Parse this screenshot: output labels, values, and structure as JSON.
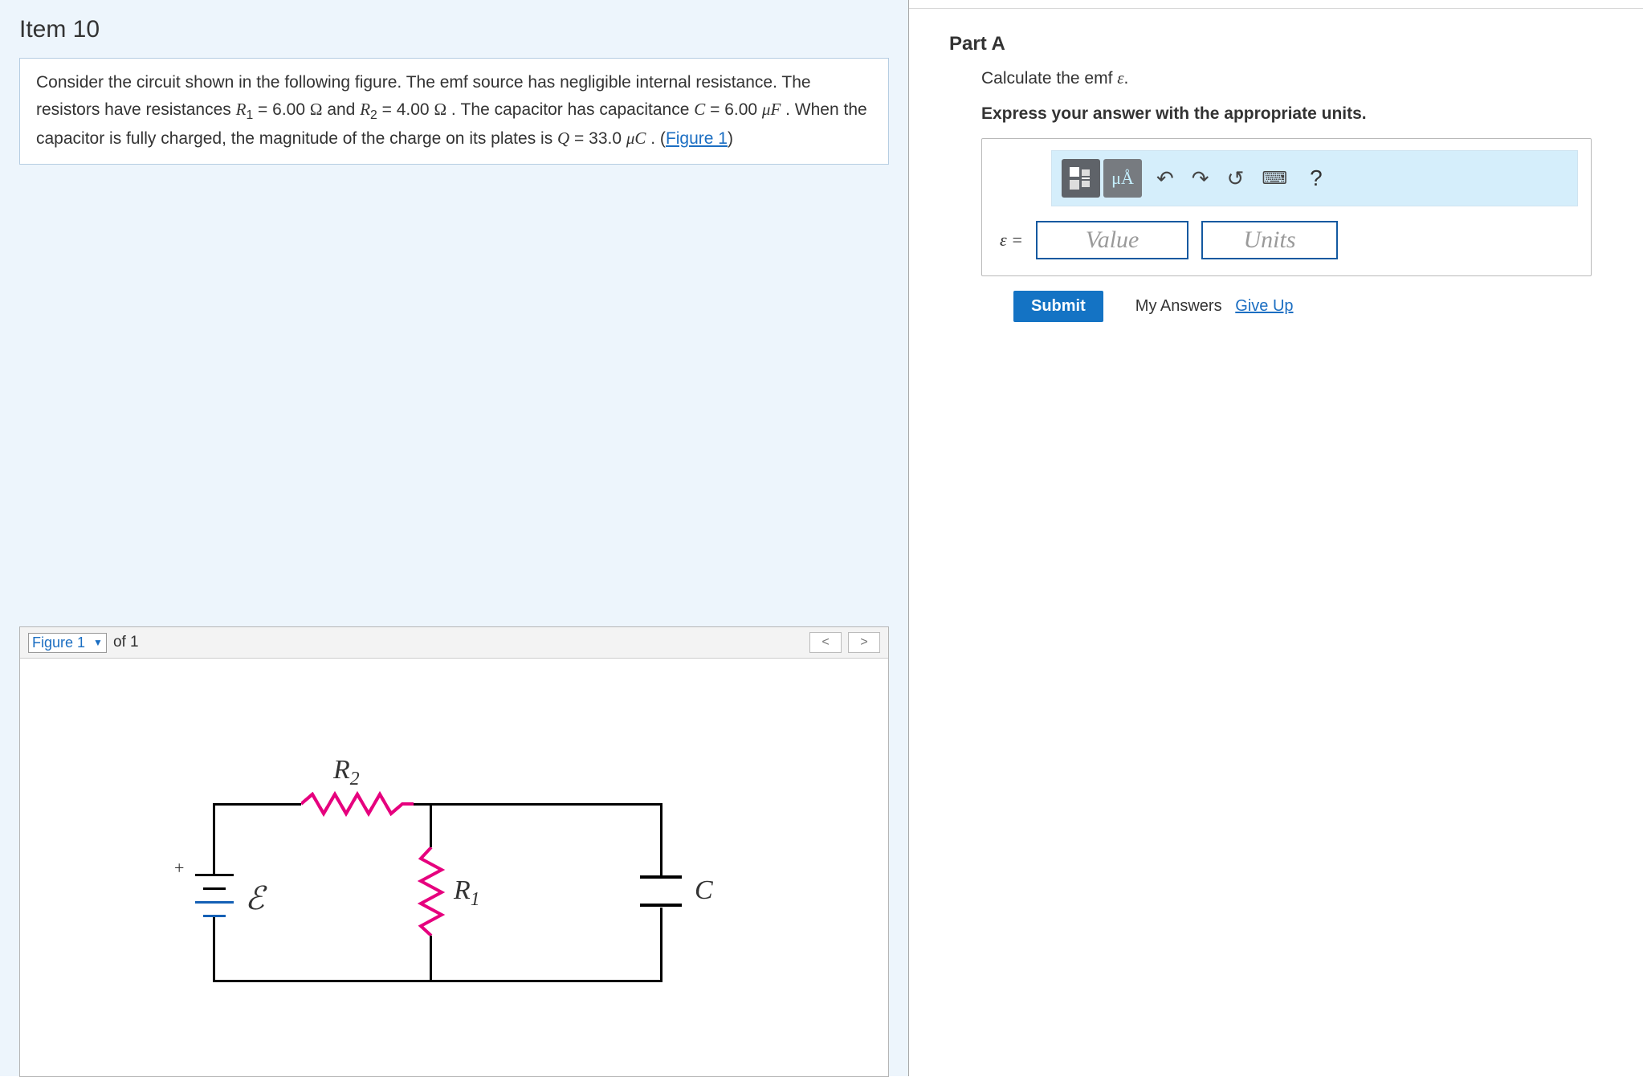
{
  "item_title": "Item 10",
  "problem": {
    "line1_a": "Consider the circuit shown in the following figure. The emf source has negligible internal resistance. The resistors have resistances ",
    "R1sym": "R",
    "R1sub": "1",
    "eq1": " = 6.00 ",
    "ohm": "Ω",
    "and": " and ",
    "R2sym": "R",
    "R2sub": "2",
    "eq2": " = 4.00 ",
    "line2_a": " . The capacitor has capacitance ",
    "Csym": "C",
    "eq3": " = 6.00 ",
    "muF": "μF",
    "line2_b": " . When the capacitor is fully charged, the magnitude of the charge on its plates is ",
    "Qsym": "Q",
    "eq4": " = 33.0 ",
    "muC": "μC",
    "period": " . (",
    "fig_link": "Figure 1",
    "close": ")"
  },
  "figure": {
    "select_label": "Figure 1",
    "of_text": "of 1",
    "prev": "<",
    "next": ">",
    "labels": {
      "R2": "R",
      "R2sub": "2",
      "R1": "R",
      "R1sub": "1",
      "E": "ℰ",
      "C": "C",
      "plus": "+"
    }
  },
  "part": {
    "title": "Part A",
    "instr1_a": "Calculate the emf ",
    "instr1_eps": "ε",
    "instr1_b": ".",
    "instr2": "Express your answer with the appropriate units.",
    "toolbar": {
      "mu_a": "μÅ",
      "help": "?"
    },
    "eq_label": "ε =",
    "value_ph": "Value",
    "units_ph": "Units",
    "submit": "Submit",
    "my_answers": "My Answers",
    "give_up": "Give Up"
  }
}
